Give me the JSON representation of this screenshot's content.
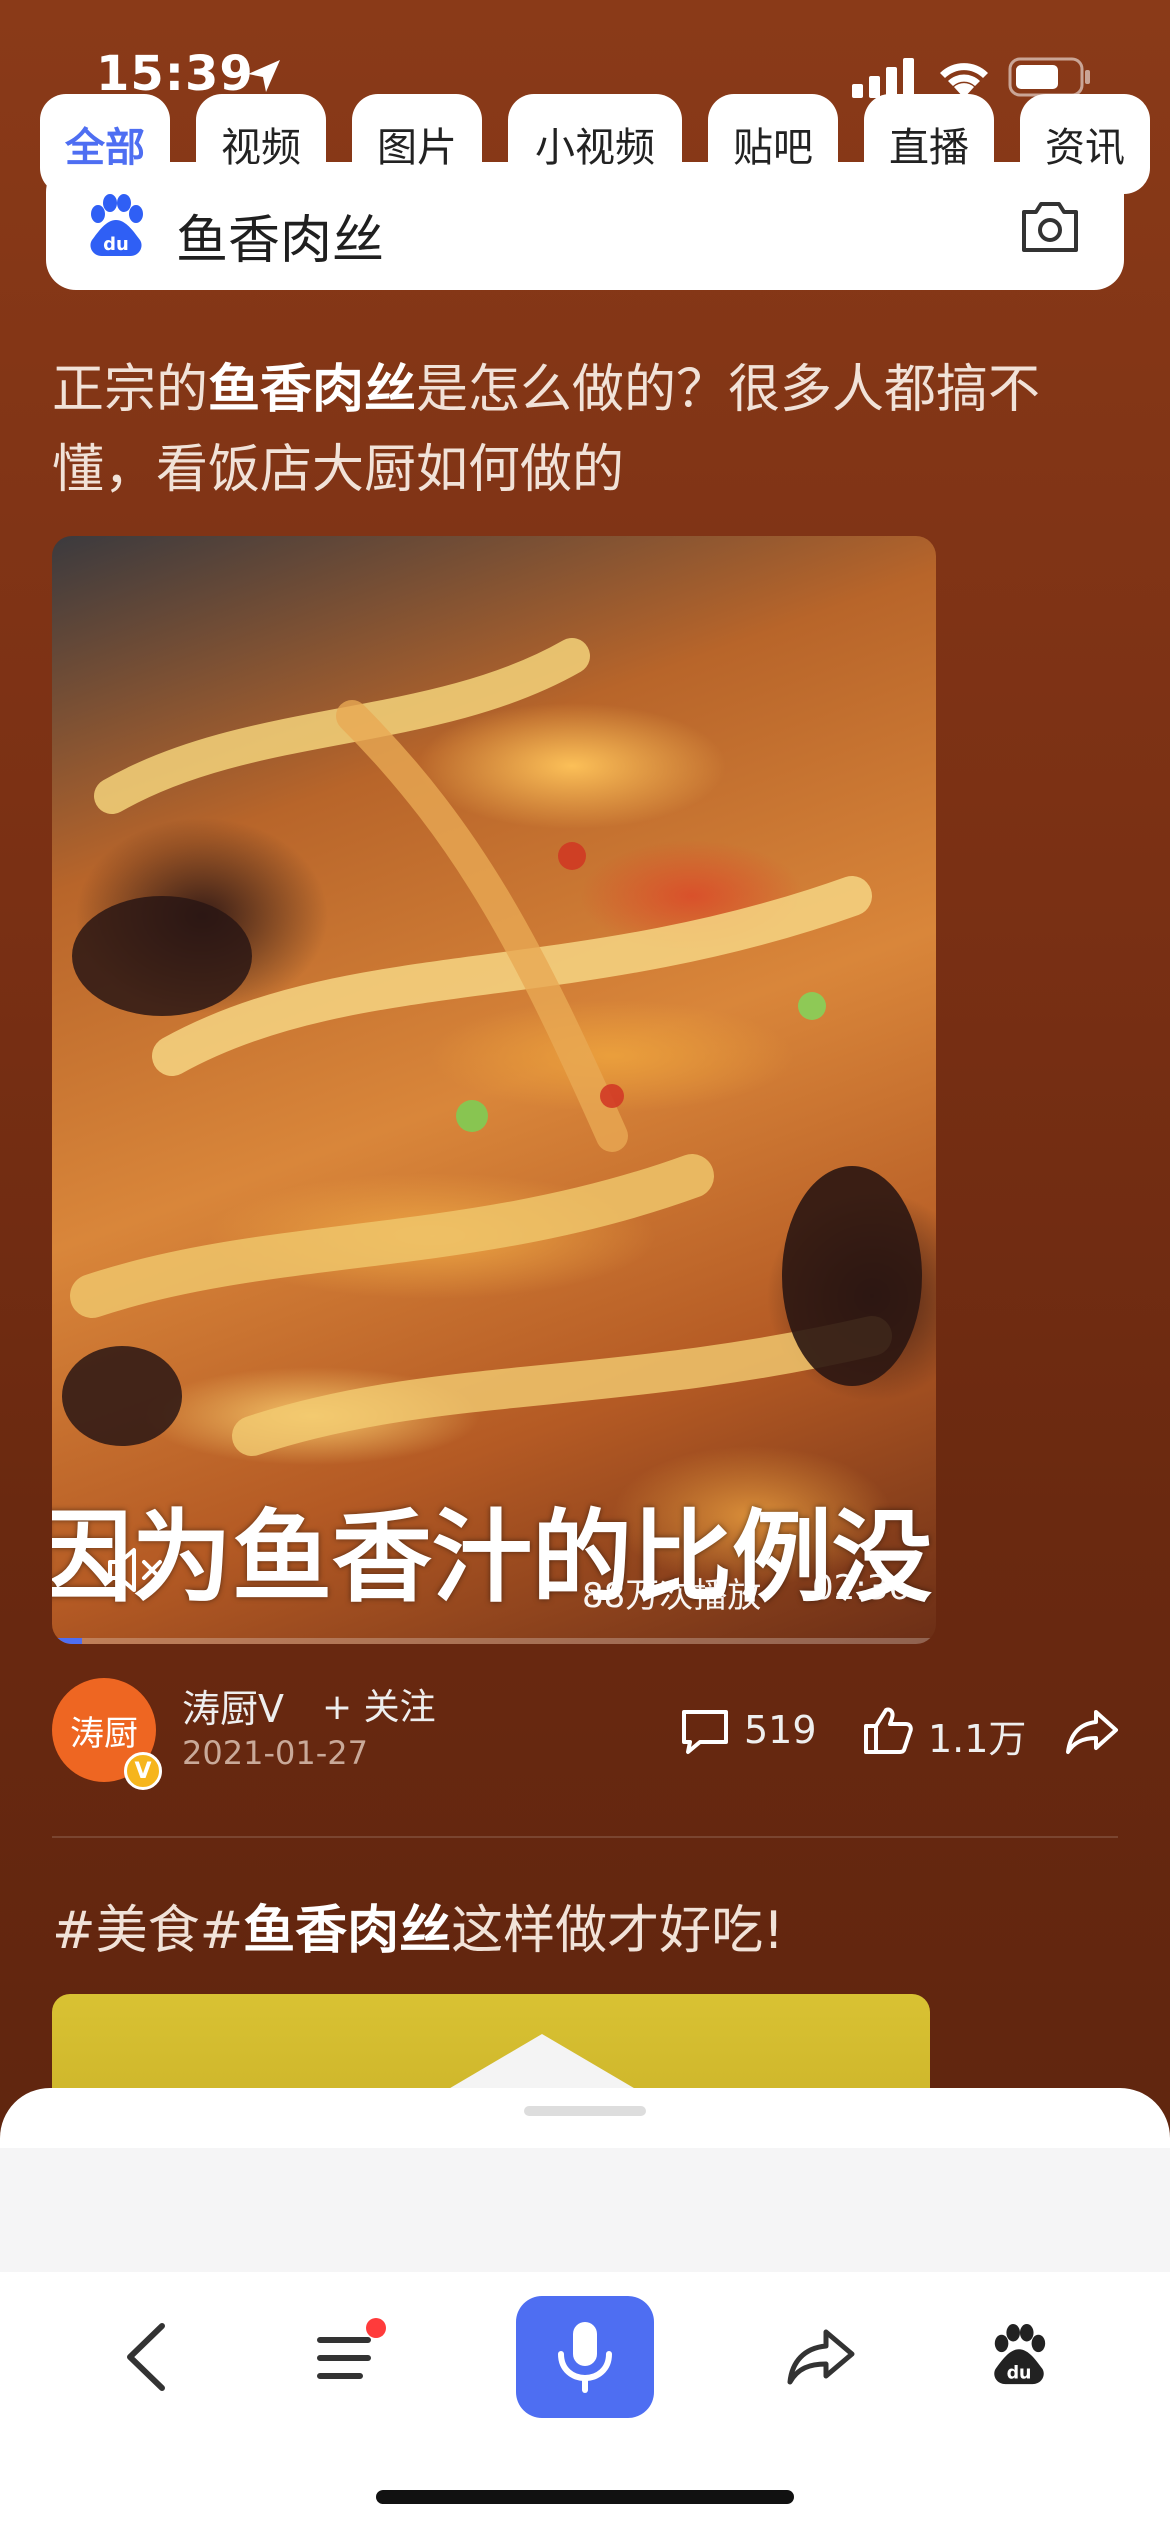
{
  "status_bar": {
    "time": "15:39"
  },
  "search": {
    "query": "鱼香肉丝"
  },
  "results": [
    {
      "title_before": "正宗的",
      "title_highlight": "鱼香肉丝",
      "title_after": "是怎么做的？很多人都搞不懂，看饭店大厨如何做的",
      "video": {
        "caption": "因为鱼香汁的比例没",
        "play_count": "88万次播放",
        "duration": "02:36",
        "progress": 0.034
      },
      "author": {
        "avatar_text": "涛厨",
        "verify_badge": "V",
        "name": "涛厨Ⅴ",
        "follow_label": "+ 关注",
        "date": "2021-01-27"
      },
      "comments": "519",
      "likes": "1.1万"
    },
    {
      "title_before": "#美食#",
      "title_highlight": "鱼香肉丝",
      "title_after": "这样做才好吃!"
    }
  ],
  "tabs": [
    "全部",
    "视频",
    "图片",
    "小视频",
    "贴吧",
    "直播",
    "资讯"
  ],
  "active_tab": "全部",
  "icons": {
    "status": [
      "location-arrow-icon",
      "signal-icon",
      "wifi-icon",
      "battery-icon"
    ],
    "search": [
      "baidu-paw-icon",
      "camera-icon"
    ],
    "post": [
      "mute-icon",
      "comment-icon",
      "like-icon",
      "share-icon"
    ],
    "nav": [
      "back-icon",
      "menu-icon",
      "microphone-icon",
      "share-icon",
      "baidu-paw-icon"
    ]
  },
  "colors": {
    "accent": "#4e6ef2",
    "background": "#7a3014",
    "notification_dot": "#ff3b3b"
  }
}
